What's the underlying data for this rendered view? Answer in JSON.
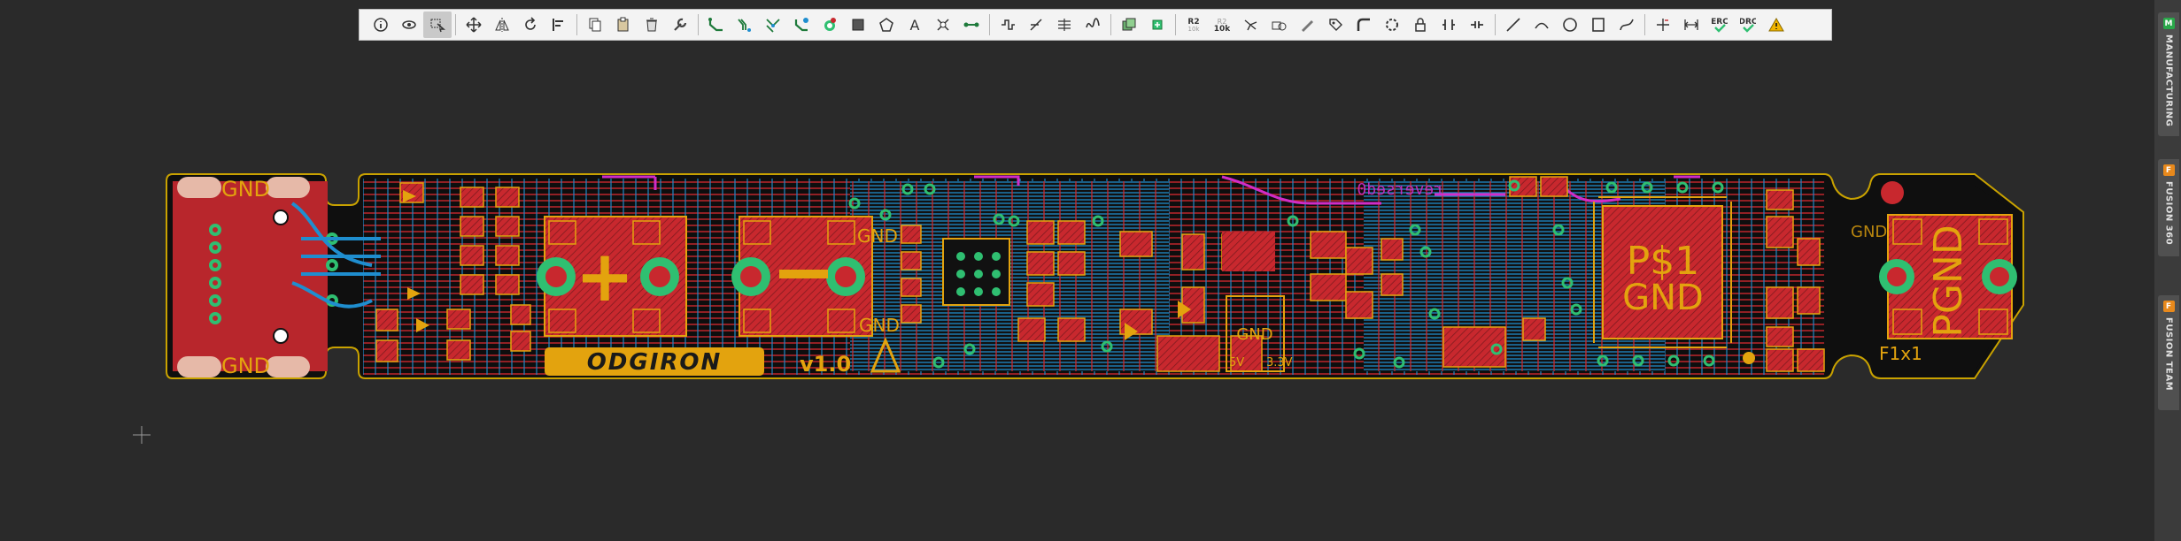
{
  "toolbar": {
    "tools": [
      {
        "name": "info-icon",
        "active": false
      },
      {
        "name": "show-icon",
        "active": false
      },
      {
        "name": "select-icon",
        "active": true
      },
      {
        "name": "sep"
      },
      {
        "name": "move-icon",
        "active": false
      },
      {
        "name": "mirror-icon",
        "active": false
      },
      {
        "name": "rotate-icon",
        "active": false
      },
      {
        "name": "align-icon",
        "active": false
      },
      {
        "name": "sep"
      },
      {
        "name": "copy-icon",
        "active": false
      },
      {
        "name": "paste-icon",
        "active": false
      },
      {
        "name": "delete-icon",
        "active": false
      },
      {
        "name": "properties-wrench-icon",
        "active": false
      },
      {
        "name": "sep"
      },
      {
        "name": "route-icon",
        "active": false
      },
      {
        "name": "route-diff-pair-icon",
        "active": false
      },
      {
        "name": "route-multiple-icon",
        "active": false
      },
      {
        "name": "ripup-icon",
        "active": false
      },
      {
        "name": "via-icon",
        "active": false
      },
      {
        "name": "smd-icon",
        "active": false
      },
      {
        "name": "polygon-icon",
        "active": false
      },
      {
        "name": "text-icon",
        "active": false
      },
      {
        "name": "fanout-icon",
        "active": false
      },
      {
        "name": "signal-icon",
        "active": false
      },
      {
        "name": "sep"
      },
      {
        "name": "meander-icon",
        "active": false
      },
      {
        "name": "slice-icon",
        "active": false
      },
      {
        "name": "optimize-icon",
        "active": false
      },
      {
        "name": "wave-icon",
        "active": false
      },
      {
        "name": "sep"
      },
      {
        "name": "group-icon",
        "active": false
      },
      {
        "name": "add-part-icon",
        "active": false
      },
      {
        "name": "sep"
      },
      {
        "name": "name-value-icon",
        "active": false
      },
      {
        "name": "value-icon",
        "active": false
      },
      {
        "name": "smash-icon",
        "active": false
      },
      {
        "name": "replace-icon",
        "active": false
      },
      {
        "name": "lock-edit-icon",
        "active": false
      },
      {
        "name": "attribute-icon",
        "active": false
      },
      {
        "name": "miter-icon",
        "active": false
      },
      {
        "name": "split-icon",
        "active": false
      },
      {
        "name": "lock-icon",
        "active": false
      },
      {
        "name": "change-icon",
        "active": false
      },
      {
        "name": "split-trace-icon",
        "active": false
      },
      {
        "name": "sep"
      },
      {
        "name": "line-icon",
        "active": false
      },
      {
        "name": "arc-icon",
        "active": false
      },
      {
        "name": "circle-icon",
        "active": false
      },
      {
        "name": "rectangle-icon",
        "active": false
      },
      {
        "name": "spline-icon",
        "active": false
      },
      {
        "name": "sep"
      },
      {
        "name": "mark-icon",
        "active": false
      },
      {
        "name": "dimension-icon",
        "active": false
      },
      {
        "name": "erc-icon",
        "active": false
      },
      {
        "name": "drc-icon",
        "active": false
      },
      {
        "name": "warning-icon",
        "active": false
      }
    ],
    "labels": {
      "name_value": "R2",
      "value_tag": "10k",
      "erc": "ERC",
      "drc": "DRC"
    }
  },
  "board": {
    "logo_text": "ODGIRON",
    "version_text": "v1.0",
    "plus_text": "+",
    "minus_text": "-",
    "gnd_text": "GND",
    "p1_text": "P$1",
    "pgnd_text": "PGND",
    "v33_left": "5V",
    "v33_right": "3.3V",
    "fx_text": "F1x1",
    "mirrored_text": "reversed0",
    "pad_label_top_left": "GND",
    "pad_label_bottom_left": "GND"
  },
  "side_tabs": [
    {
      "label": "MANUFACTURING",
      "color": "#2aa84a",
      "letter": "M"
    },
    {
      "label": "FUSION 360",
      "color": "#e8891c",
      "letter": "F"
    },
    {
      "label": "FUSION TEAM",
      "color": "#e8891c",
      "letter": "F"
    }
  ],
  "colors": {
    "background": "#2a2a2a",
    "top_copper": "#c8282e",
    "bottom_copper": "#1f8ecf",
    "silk": "#e3a30e",
    "via": "#2fbf71",
    "outline": "#c9a200",
    "magenta": "#d22cc7"
  }
}
